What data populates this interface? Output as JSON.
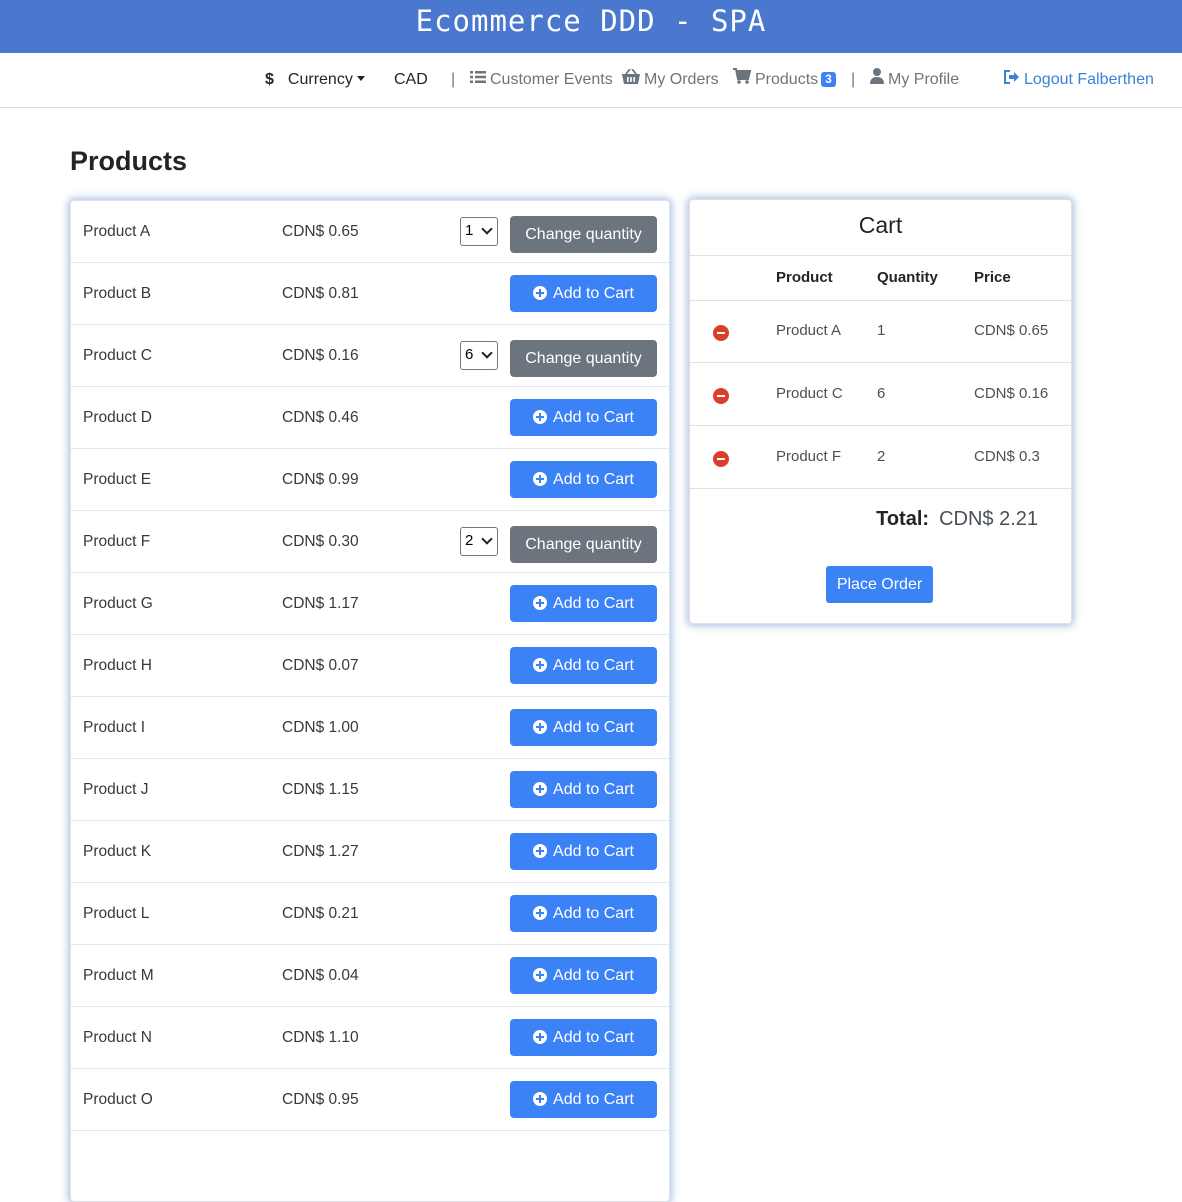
{
  "app": {
    "title": "Ecommerce DDD - SPA"
  },
  "nav": {
    "currency_label": "Currency",
    "currency_value": "CAD",
    "customer_events": "Customer Events",
    "my_orders": "My Orders",
    "products": "Products",
    "products_badge": "3",
    "my_profile": "My Profile",
    "logout": "Logout Falberthen",
    "separator": "|"
  },
  "page": {
    "title": "Products"
  },
  "labels": {
    "add_to_cart": "Add to Cart",
    "change_quantity": "Change quantity"
  },
  "products": [
    {
      "name": "Product A",
      "price": "CDN$ 0.65",
      "in_cart": true,
      "quantity": "1"
    },
    {
      "name": "Product B",
      "price": "CDN$ 0.81",
      "in_cart": false
    },
    {
      "name": "Product C",
      "price": "CDN$ 0.16",
      "in_cart": true,
      "quantity": "6"
    },
    {
      "name": "Product D",
      "price": "CDN$ 0.46",
      "in_cart": false
    },
    {
      "name": "Product E",
      "price": "CDN$ 0.99",
      "in_cart": false
    },
    {
      "name": "Product F",
      "price": "CDN$ 0.30",
      "in_cart": true,
      "quantity": "2"
    },
    {
      "name": "Product G",
      "price": "CDN$ 1.17",
      "in_cart": false
    },
    {
      "name": "Product H",
      "price": "CDN$ 0.07",
      "in_cart": false
    },
    {
      "name": "Product I",
      "price": "CDN$ 1.00",
      "in_cart": false
    },
    {
      "name": "Product J",
      "price": "CDN$ 1.15",
      "in_cart": false
    },
    {
      "name": "Product K",
      "price": "CDN$ 1.27",
      "in_cart": false
    },
    {
      "name": "Product L",
      "price": "CDN$ 0.21",
      "in_cart": false
    },
    {
      "name": "Product M",
      "price": "CDN$ 0.04",
      "in_cart": false
    },
    {
      "name": "Product N",
      "price": "CDN$ 1.10",
      "in_cart": false
    },
    {
      "name": "Product O",
      "price": "CDN$ 0.95",
      "in_cart": false
    }
  ],
  "cart": {
    "title": "Cart",
    "headers": {
      "product": "Product",
      "quantity": "Quantity",
      "price": "Price"
    },
    "items": [
      {
        "product": "Product A",
        "quantity": "1",
        "price": "CDN$ 0.65"
      },
      {
        "product": "Product C",
        "quantity": "6",
        "price": "CDN$ 0.16"
      },
      {
        "product": "Product F",
        "quantity": "2",
        "price": "CDN$ 0.3"
      }
    ],
    "total_label": "Total:",
    "total_value": "CDN$ 2.21",
    "place_order": "Place Order"
  },
  "colors": {
    "banner": "#4a78cf",
    "primary": "#3b82f6",
    "secondary": "#6c757d",
    "danger": "#dc3e2c"
  }
}
